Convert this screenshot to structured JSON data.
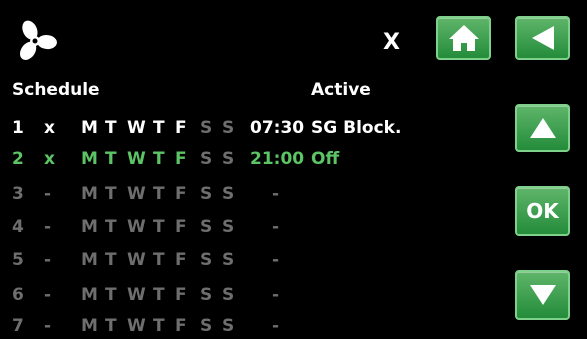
{
  "header": {
    "close_label": "X",
    "schedule_label": "Schedule",
    "active_label": "Active"
  },
  "buttons": {
    "ok_label": "OK"
  },
  "colors": {
    "accent_green": "#3aa34c",
    "active_row": "#5cc465",
    "inactive_text": "#6e6e6e"
  },
  "icons": [
    "fan-icon",
    "home-icon",
    "back-arrow-icon",
    "up-arrow-icon",
    "down-arrow-icon"
  ],
  "schedule": [
    {
      "num": "1",
      "x": "x",
      "days": [
        "M",
        "T",
        "W",
        "T",
        "F",
        "S",
        "S"
      ],
      "time": "07:30",
      "active": "SG Block."
    },
    {
      "num": "2",
      "x": "x",
      "days": [
        "M",
        "T",
        "W",
        "T",
        "F",
        "S",
        "S"
      ],
      "time": "21:00",
      "active": "Off"
    },
    {
      "num": "3",
      "x": "-",
      "days": [
        "M",
        "T",
        "W",
        "T",
        "F",
        "S",
        "S"
      ],
      "time": "-",
      "active": ""
    },
    {
      "num": "4",
      "x": "-",
      "days": [
        "M",
        "T",
        "W",
        "T",
        "F",
        "S",
        "S"
      ],
      "time": "-",
      "active": ""
    },
    {
      "num": "5",
      "x": "-",
      "days": [
        "M",
        "T",
        "W",
        "T",
        "F",
        "S",
        "S"
      ],
      "time": "-",
      "active": ""
    },
    {
      "num": "6",
      "x": "-",
      "days": [
        "M",
        "T",
        "W",
        "T",
        "F",
        "S",
        "S"
      ],
      "time": "-",
      "active": ""
    },
    {
      "num": "7",
      "x": "-",
      "days": [
        "M",
        "T",
        "W",
        "T",
        "F",
        "S",
        "S"
      ],
      "time": "-",
      "active": ""
    }
  ]
}
